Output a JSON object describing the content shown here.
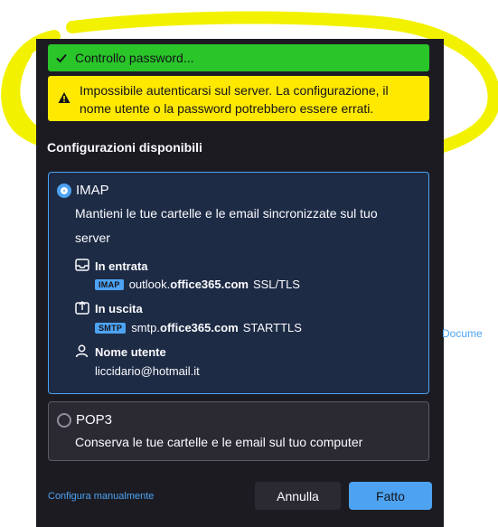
{
  "banners": {
    "checking": "Controllo password...",
    "error": "Impossibile autenticarsi sul server. La configurazione, il nome utente o la password potrebbero essere errati."
  },
  "section_title": "Configurazioni disponibili",
  "imap": {
    "label": "IMAP",
    "description": "Mantieni le tue cartelle e le email sincronizzate sul tuo server",
    "incoming_label": "In entrata",
    "incoming_tag": "IMAP",
    "incoming_host_prefix": "outlook.",
    "incoming_host_domain": "office365.com",
    "incoming_security": "SSL/TLS",
    "outgoing_label": "In uscita",
    "outgoing_tag": "SMTP",
    "outgoing_host_prefix": "smtp.",
    "outgoing_host_domain": "office365.com",
    "outgoing_security": "STARTTLS",
    "username_label": "Nome utente",
    "username": "liccidario@hotmail.it"
  },
  "pop3": {
    "label": "POP3",
    "description": "Conserva le tue cartelle e le email sul tuo computer"
  },
  "footer": {
    "manual_link": "Configura manualmente",
    "cancel_label": "Annulla",
    "done_label": "Fatto"
  },
  "side_link": "Docume",
  "colors": {
    "accent": "#4da3f2",
    "success": "#29c529",
    "warning": "#ffe900",
    "highlight_stroke": "#f2f200",
    "dialog_bg": "#1c1b22"
  },
  "icons": {
    "checking": "check-icon",
    "error": "warning-icon",
    "incoming": "inbox-icon",
    "outgoing": "outbox-icon",
    "username": "user-icon"
  }
}
